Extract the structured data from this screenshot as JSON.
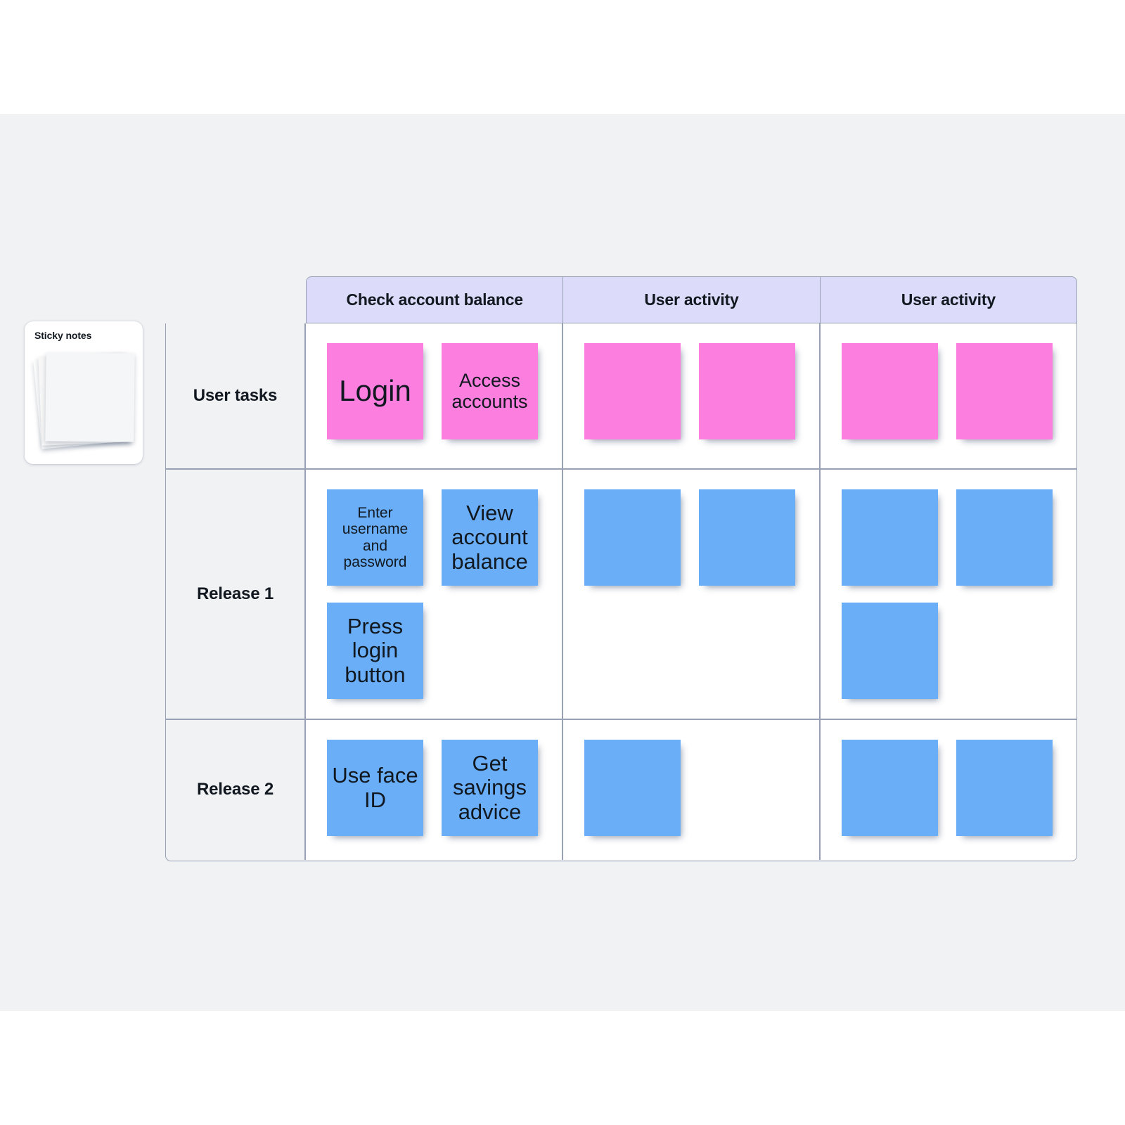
{
  "palette": {
    "title": "Sticky notes",
    "note_count": 3
  },
  "colors": {
    "canvas": "#f1f2f4",
    "header_bg": "#dcdcfa",
    "grid_line": "#98a1b3",
    "note_pink": "#fc7fdf",
    "note_blue": "#6aaef8",
    "cell_bg": "#ffffff",
    "row_label_bg": "#f1f2f4",
    "text": "#11181f"
  },
  "map": {
    "column_headers": [
      "Check account balance",
      "User activity",
      "User activity"
    ],
    "row_labels": [
      "User tasks",
      "Release 1",
      "Release 2"
    ],
    "rows": [
      {
        "label": "User tasks",
        "cells": [
          [
            {
              "text": "Login",
              "color": "pink",
              "size": "fs-xl"
            },
            {
              "text": "Access accounts",
              "color": "pink",
              "size": "fs-md"
            }
          ],
          [
            {
              "text": "",
              "color": "pink",
              "size": "fs-md"
            },
            {
              "text": "",
              "color": "pink",
              "size": "fs-md"
            }
          ],
          [
            {
              "text": "",
              "color": "pink",
              "size": "fs-md"
            },
            {
              "text": "",
              "color": "pink",
              "size": "fs-md"
            }
          ]
        ]
      },
      {
        "label": "Release 1",
        "cells": [
          [
            {
              "text": "Enter username and password",
              "color": "blue",
              "size": "fs-sm"
            },
            {
              "text": "View account balance",
              "color": "blue",
              "size": "fs-lg"
            },
            {
              "text": "Press login button",
              "color": "blue",
              "size": "fs-lg"
            }
          ],
          [
            {
              "text": "",
              "color": "blue",
              "size": "fs-md"
            },
            {
              "text": "",
              "color": "blue",
              "size": "fs-md"
            }
          ],
          [
            {
              "text": "",
              "color": "blue",
              "size": "fs-md"
            },
            {
              "text": "",
              "color": "blue",
              "size": "fs-md"
            },
            {
              "text": "",
              "color": "blue",
              "size": "fs-md"
            }
          ]
        ]
      },
      {
        "label": "Release 2",
        "cells": [
          [
            {
              "text": "Use face ID",
              "color": "blue",
              "size": "fs-lg"
            },
            {
              "text": "Get savings advice",
              "color": "blue",
              "size": "fs-lg"
            }
          ],
          [
            {
              "text": "",
              "color": "blue",
              "size": "fs-md"
            }
          ],
          [
            {
              "text": "",
              "color": "blue",
              "size": "fs-md"
            },
            {
              "text": "",
              "color": "blue",
              "size": "fs-md"
            }
          ]
        ]
      }
    ]
  }
}
